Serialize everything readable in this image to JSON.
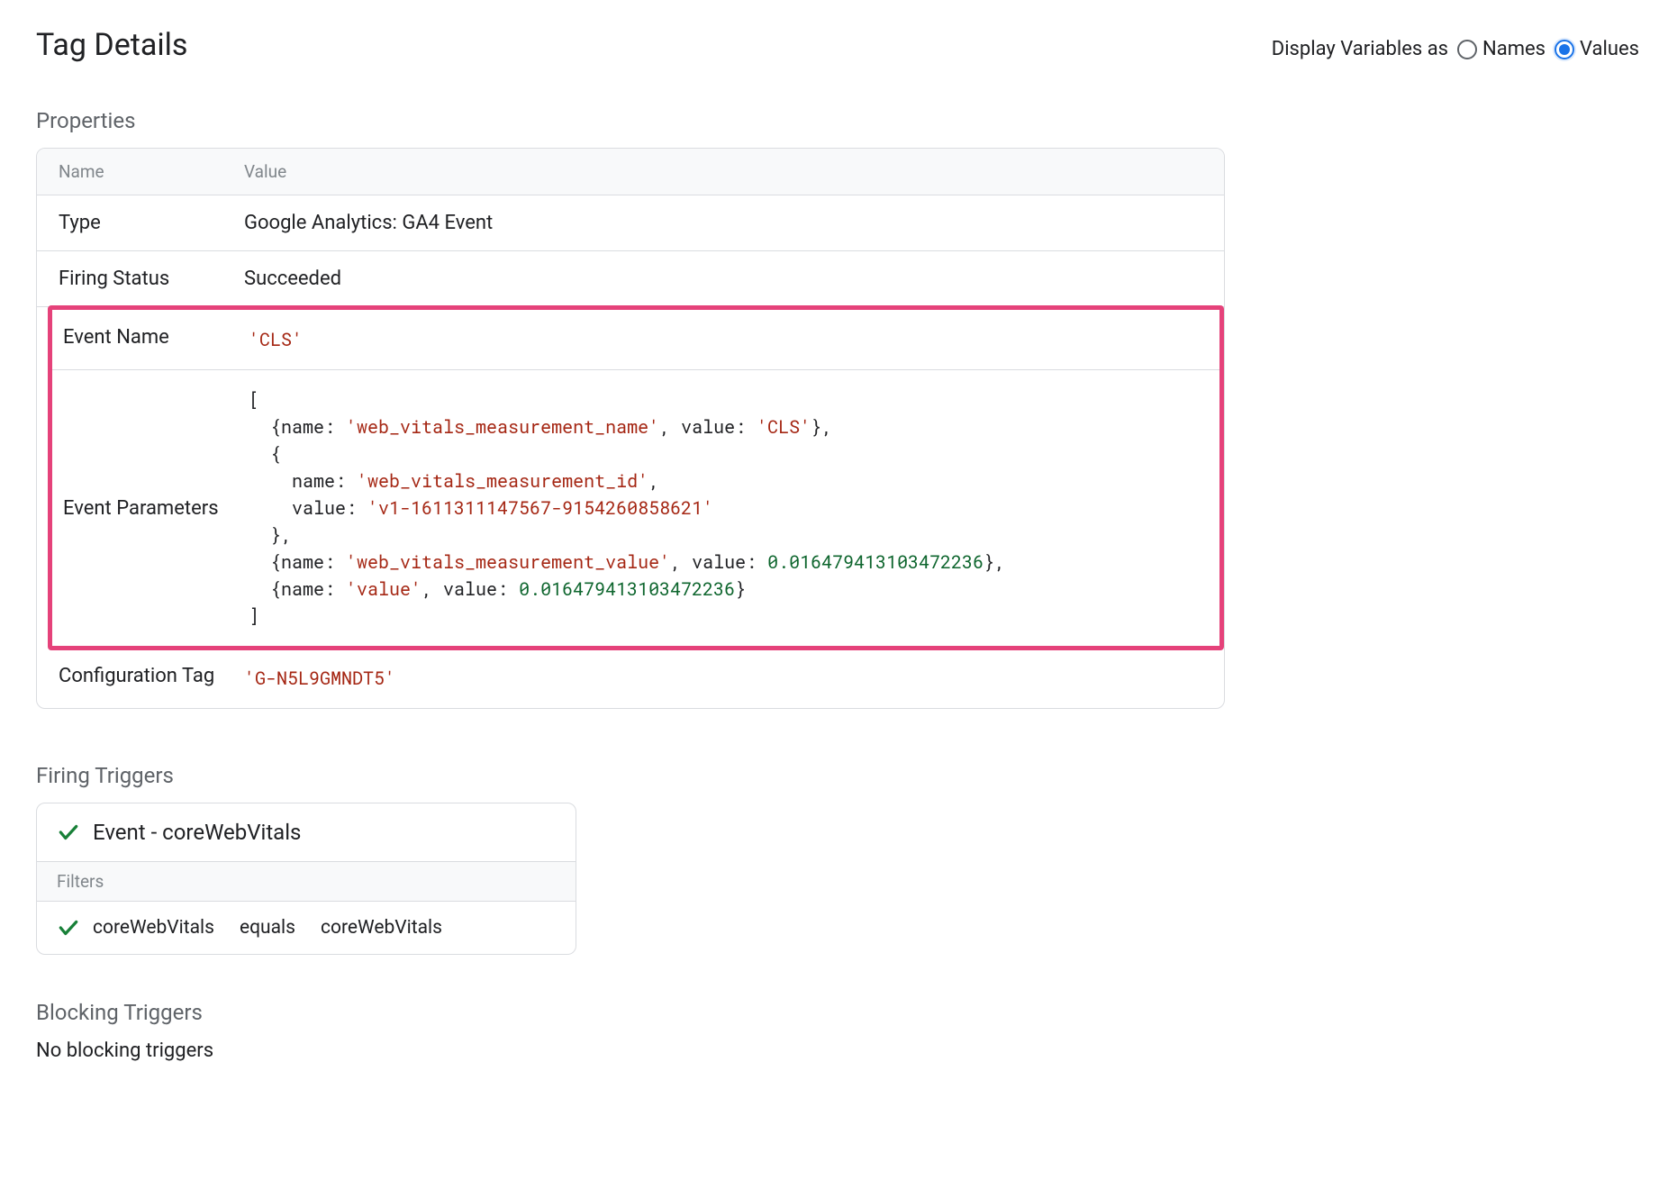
{
  "header": {
    "title": "Tag Details",
    "display_label": "Display Variables as",
    "display_options": {
      "names": "Names",
      "values": "Values"
    },
    "display_selected": "values"
  },
  "properties": {
    "heading": "Properties",
    "columns": {
      "name": "Name",
      "value": "Value"
    },
    "type": {
      "label": "Type",
      "value": "Google Analytics: GA4 Event"
    },
    "firing_status": {
      "label": "Firing Status",
      "value": "Succeeded"
    },
    "event_name": {
      "label": "Event Name",
      "value": "'CLS'"
    },
    "event_params": {
      "label": "Event Parameters"
    },
    "config_tag": {
      "label": "Configuration Tag",
      "value": "'G-N5L9GMNDT5'"
    }
  },
  "code": {
    "open": "[",
    "line1a": "  {name: ",
    "line1b": "'web_vitals_measurement_name'",
    "line1c": ", value: ",
    "line1d": "'CLS'",
    "line1e": "},",
    "line2": "  {",
    "line3a": "    name: ",
    "line3b": "'web_vitals_measurement_id'",
    "line3c": ",",
    "line4a": "    value: ",
    "line4b": "'v1-1611311147567-9154260858621'",
    "line5": "  },",
    "line6a": "  {name: ",
    "line6b": "'web_vitals_measurement_value'",
    "line6c": ", value: ",
    "line6d": "0.016479413103472236",
    "line6e": "},",
    "line7a": "  {name: ",
    "line7b": "'value'",
    "line7c": ", value: ",
    "line7d": "0.016479413103472236",
    "line7e": "}",
    "close": "]"
  },
  "firing": {
    "heading": "Firing Triggers",
    "trigger_name": "Event - coreWebVitals",
    "filters_label": "Filters",
    "filter": {
      "left": "coreWebVitals",
      "op": "equals",
      "right": "coreWebVitals"
    }
  },
  "blocking": {
    "heading": "Blocking Triggers",
    "text": "No blocking triggers"
  }
}
